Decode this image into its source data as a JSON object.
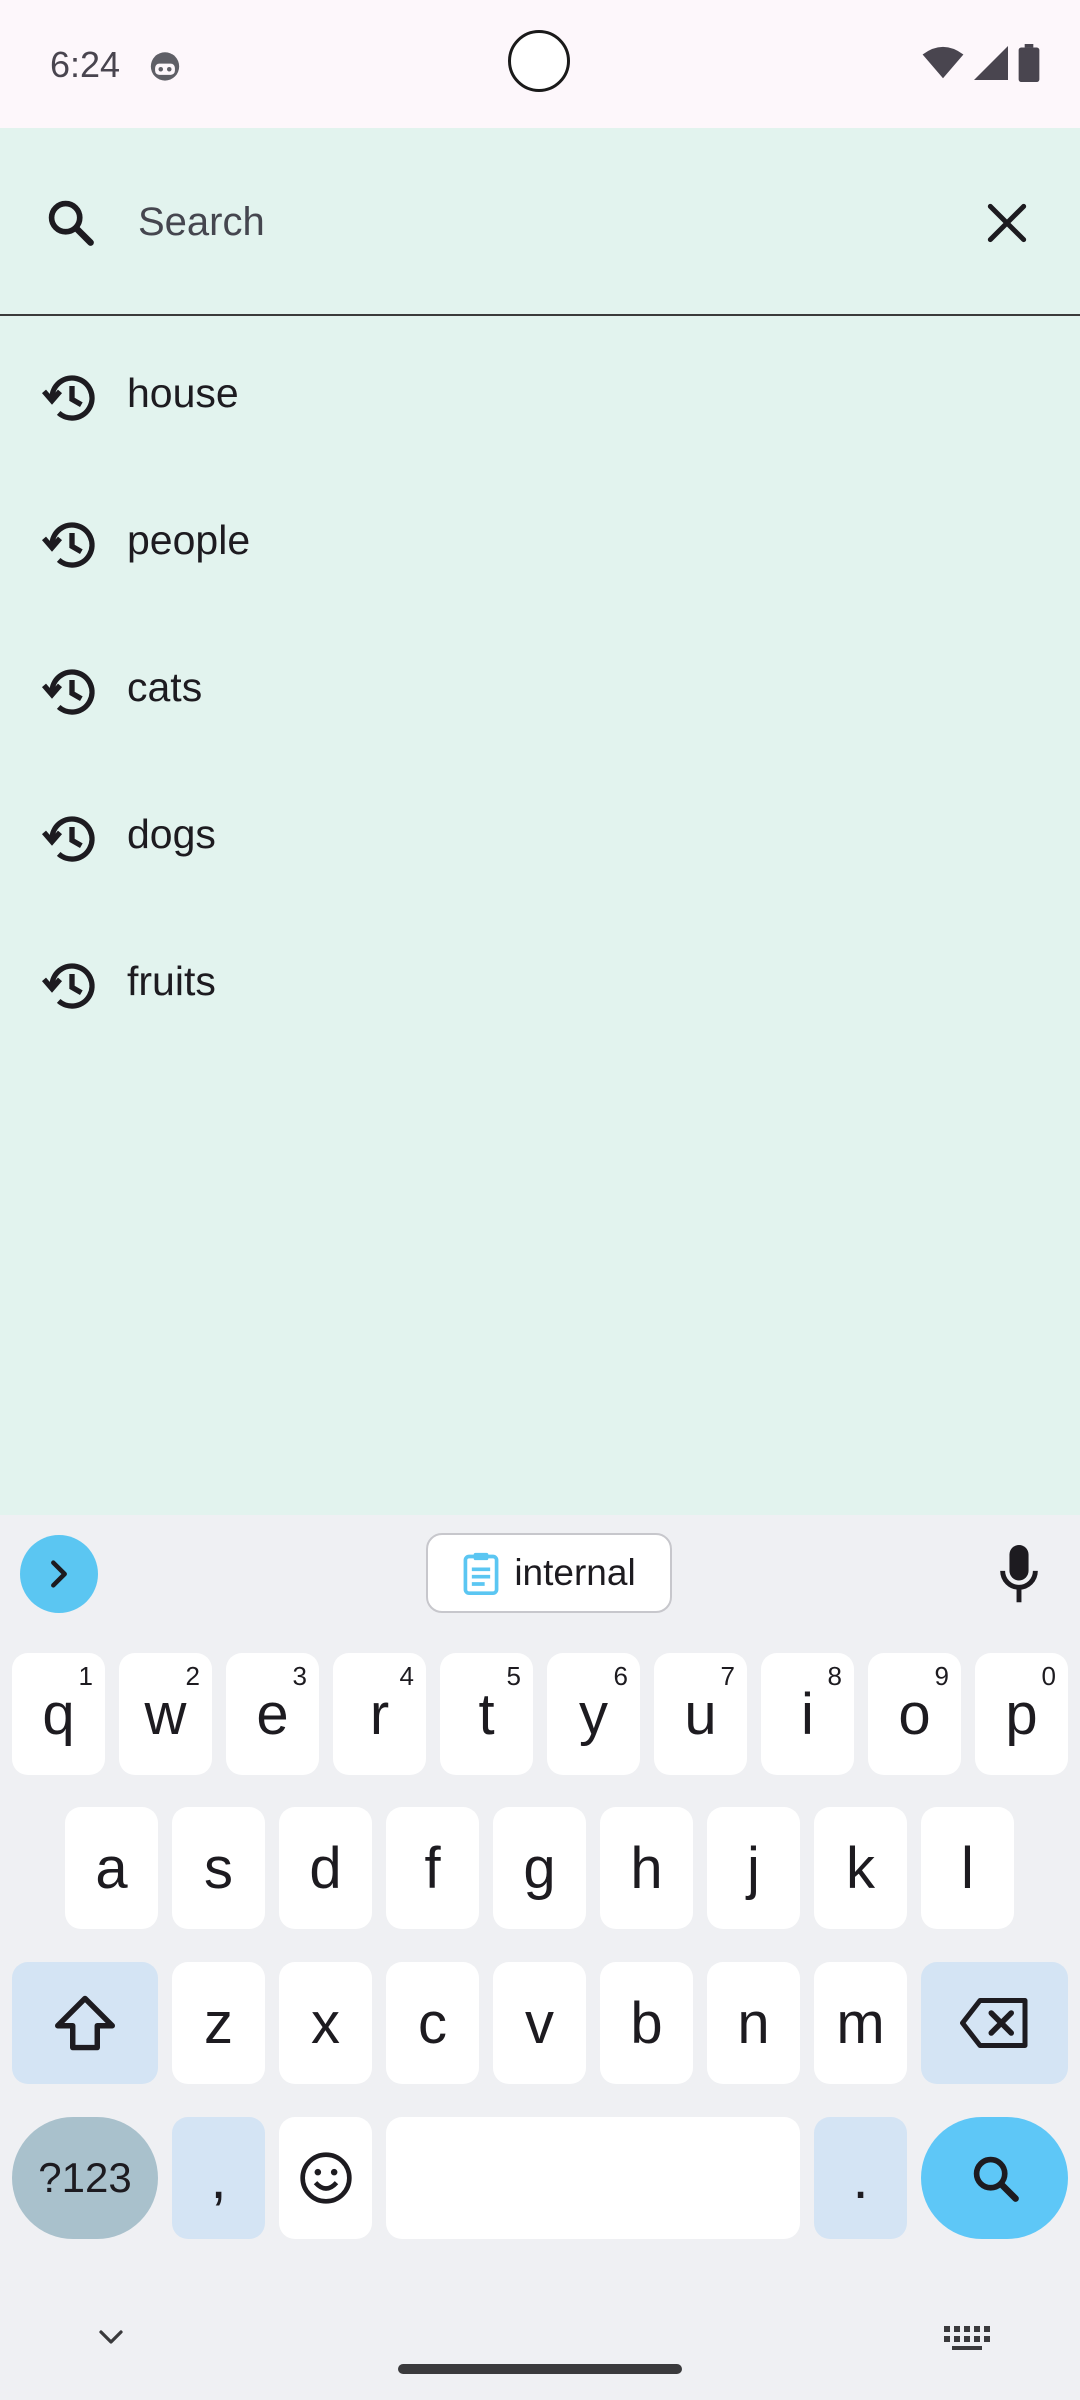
{
  "status": {
    "time": "6:24"
  },
  "search": {
    "placeholder": "Search"
  },
  "history": [
    "house",
    "people",
    "cats",
    "dogs",
    "fruits"
  ],
  "keyboard": {
    "clipboard_text": "internal",
    "row1": [
      "q",
      "w",
      "e",
      "r",
      "t",
      "y",
      "u",
      "i",
      "o",
      "p"
    ],
    "row1_hints": [
      "1",
      "2",
      "3",
      "4",
      "5",
      "6",
      "7",
      "8",
      "9",
      "0"
    ],
    "row2": [
      "a",
      "s",
      "d",
      "f",
      "g",
      "h",
      "j",
      "k",
      "l"
    ],
    "row3": [
      "z",
      "x",
      "c",
      "v",
      "b",
      "n",
      "m"
    ],
    "symbols_label": "?123",
    "comma": ",",
    "period": "."
  },
  "colors": {
    "background": "#e2f3ee",
    "accent": "#5ec7f7",
    "modifier": "#d4e4f4"
  }
}
